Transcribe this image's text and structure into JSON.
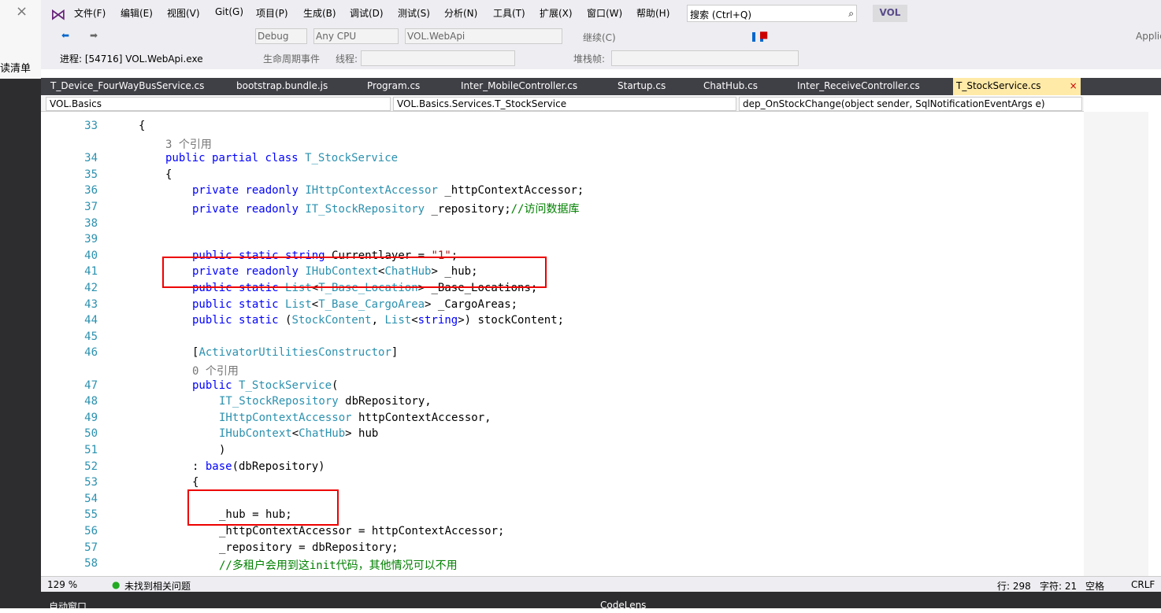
{
  "menu": [
    "文件(F)",
    "编辑(E)",
    "视图(V)",
    "Git(G)",
    "项目(P)",
    "生成(B)",
    "调试(D)",
    "测试(S)",
    "分析(N)",
    "工具(T)",
    "扩展(X)",
    "窗口(W)",
    "帮助(H)"
  ],
  "search": "搜索 (Ctrl+Q)",
  "solution": "VOL",
  "left": "读清单",
  "toolbar": {
    "config": "Debug",
    "platform": "Any CPU",
    "project": "VOL.WebApi",
    "continue": "继续(C)",
    "process": "进程: [54716] VOL.WebApi.exe",
    "events": "生命周期事件",
    "thread": "线程:",
    "stack": "堆栈帧:",
    "app": "Applic"
  },
  "tabs": [
    "T_Device_FourWayBusService.cs",
    "bootstrap.bundle.js",
    "Program.cs",
    "Inter_MobileController.cs",
    "Startup.cs",
    "ChatHub.cs",
    "Inter_ReceiveController.cs",
    "T_StockService.cs"
  ],
  "nav": [
    "VOL.Basics",
    "VOL.Basics.Services.T_StockService",
    "dep_OnStockChange(object sender, SqlNotificationEventArgs e)"
  ],
  "lines": [
    {
      "n": "33",
      "t": "{"
    },
    {
      "n": "",
      "t": "3 个引用"
    },
    {
      "n": "34",
      "t": "public partial class T_StockService"
    },
    {
      "n": "35",
      "t": "{"
    },
    {
      "n": "36",
      "t": "private readonly IHttpContextAccessor _httpContextAccessor;"
    },
    {
      "n": "37",
      "t": "private readonly IT_StockRepository _repository;//访问数据库"
    },
    {
      "n": "38",
      "t": ""
    },
    {
      "n": "39",
      "t": ""
    },
    {
      "n": "40",
      "t": "public static string Currentlayer = \"1\";"
    },
    {
      "n": "41",
      "t": "private readonly IHubContext<ChatHub> _hub;"
    },
    {
      "n": "42",
      "t": "public static List<T_Base_Location> _Base_Locations;"
    },
    {
      "n": "43",
      "t": "public static List<T_Base_CargoArea> _CargoAreas;"
    },
    {
      "n": "44",
      "t": "public static (StockContent, List<string>) stockContent;"
    },
    {
      "n": "45",
      "t": ""
    },
    {
      "n": "46",
      "t": "[ActivatorUtilitiesConstructor]"
    },
    {
      "n": "",
      "t": "0 个引用"
    },
    {
      "n": "47",
      "t": "public T_StockService("
    },
    {
      "n": "48",
      "t": "IT_StockRepository dbRepository,"
    },
    {
      "n": "49",
      "t": "IHttpContextAccessor httpContextAccessor,"
    },
    {
      "n": "50",
      "t": "IHubContext<ChatHub> hub"
    },
    {
      "n": "51",
      "t": ")"
    },
    {
      "n": "52",
      "t": ": base(dbRepository)"
    },
    {
      "n": "53",
      "t": "{"
    },
    {
      "n": "54",
      "t": ""
    },
    {
      "n": "55",
      "t": "_hub = hub;"
    },
    {
      "n": "56",
      "t": "_httpContextAccessor = httpContextAccessor;"
    },
    {
      "n": "57",
      "t": "_repository = dbRepository;"
    },
    {
      "n": "58",
      "t": "//多租户会用到这init代码，其他情况可以不用"
    }
  ],
  "status": {
    "zoom": "129 %",
    "issues": "未找到相关问题",
    "line": "行: 298",
    "char": "字符: 21",
    "space": "空格",
    "eol": "CRLF"
  },
  "bottom": {
    "left": "自动窗口",
    "right": "CodeLens"
  }
}
